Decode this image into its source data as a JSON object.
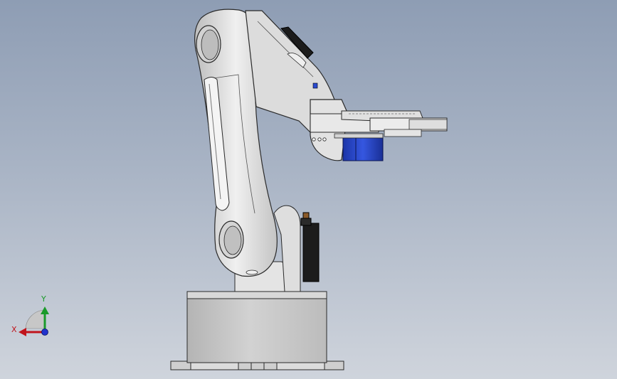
{
  "viewport": {
    "background_top": "#8e9db4",
    "background_bottom": "#cfd4dc"
  },
  "model": {
    "body_color": "#e6e6e6",
    "outline_color": "#2a2a2a",
    "servo_color_blue": "#2445c8",
    "servo_color_black": "#1c1c1c"
  },
  "triad": {
    "x_label": "X",
    "y_label": "Y",
    "x_color": "#c0141c",
    "y_color": "#1a9a2a",
    "z_color": "#2233cc"
  }
}
